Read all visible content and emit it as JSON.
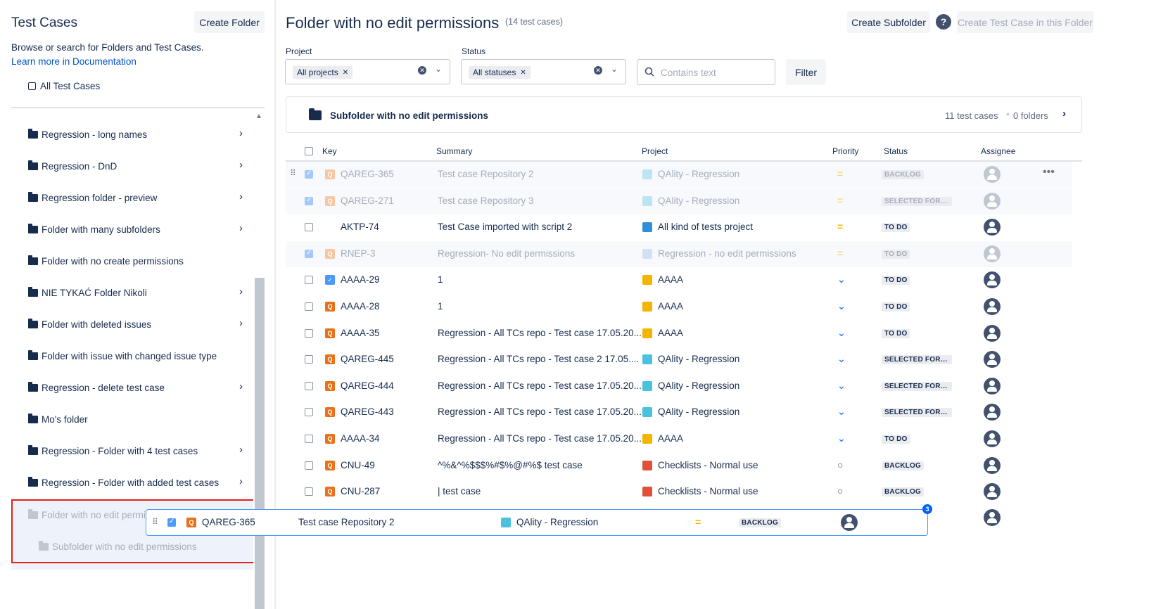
{
  "sidebar": {
    "title": "Test Cases",
    "create_folder_label": "Create Folder",
    "description": "Browse or search for Folders and Test Cases.",
    "learn_more_link": "Learn more in Documentation",
    "all_test_cases_label": "All Test Cases",
    "folders": [
      {
        "label": "Regression - long names",
        "has_children": true
      },
      {
        "label": "Regression - DnD",
        "has_children": true
      },
      {
        "label": "Regression folder - preview",
        "has_children": true
      },
      {
        "label": "Folder with many subfolders",
        "has_children": true
      },
      {
        "label": "Folder with no create permissions",
        "has_children": false
      },
      {
        "label": "NIE TYKAĆ Folder Nikoli",
        "has_children": true
      },
      {
        "label": "Folder with deleted issues",
        "has_children": true
      },
      {
        "label": "Folder with issue with changed issue type",
        "has_children": false
      },
      {
        "label": "Regression - delete test case",
        "has_children": true
      },
      {
        "label": "Mo's folder",
        "has_children": false
      },
      {
        "label": "Regression - Folder with 4 test cases",
        "has_children": true
      },
      {
        "label": "Regression - Folder with added test cases",
        "has_children": true
      }
    ],
    "ghost_folders": [
      {
        "label": "Folder with no edit permis"
      },
      {
        "label": "Subfolder with no edit permissions"
      }
    ]
  },
  "header": {
    "title": "Folder with no edit permissions",
    "count": "(14 test cases)",
    "create_subfolder_label": "Create Subfolder",
    "help_label": "?",
    "create_test_case_label": "Create Test Case in this Folder"
  },
  "filters": {
    "project_label": "Project",
    "project_chip": "All projects",
    "status_label": "Status",
    "status_chip": "All statuses",
    "search_placeholder": "Contains text",
    "filter_button": "Filter"
  },
  "subfolder_card": {
    "name": "Subfolder with no edit permissions",
    "test_cases": "11 test cases",
    "folders": "0 folders"
  },
  "table": {
    "columns": [
      "Key",
      "Summary",
      "Project",
      "Priority",
      "Status",
      "Assignee"
    ],
    "rows": [
      {
        "key": "QAREG-365",
        "summary": "Test case Repository 2",
        "project": "QAlity - Regression",
        "priority": "=",
        "status": "BACKLOG",
        "selected": true,
        "faded": true,
        "type": "orange",
        "pcolor": "#4bc1e0"
      },
      {
        "key": "QAREG-271",
        "summary": "Test case Repository 3",
        "project": "QAlity - Regression",
        "priority": "=",
        "status": "SELECTED FOR I...",
        "selected": true,
        "faded": true,
        "type": "orange",
        "pcolor": "#4bc1e0"
      },
      {
        "key": "AKTP-74",
        "summary": "Test Case imported with script 2",
        "project": "All kind of tests project",
        "priority": "=",
        "status": "TO DO",
        "selected": false,
        "faded": false,
        "type": "none",
        "pcolor": "#2f8fd8"
      },
      {
        "key": "RNEP-3",
        "summary": "Regression- No edit permissions",
        "project": "Regression - no edit permissions",
        "priority": "=",
        "status": "TO DO",
        "selected": true,
        "faded": true,
        "type": "orange",
        "pcolor": "#8eb3f0"
      },
      {
        "key": "AAAA-29",
        "summary": "1",
        "project": "AAAA",
        "priority": "⌄",
        "status": "TO DO",
        "selected": false,
        "faded": false,
        "type": "blue",
        "pcolor": "#f5b400"
      },
      {
        "key": "AAAA-28",
        "summary": "1",
        "project": "AAAA",
        "priority": "⌄",
        "status": "TO DO",
        "selected": false,
        "faded": false,
        "type": "orange",
        "pcolor": "#f5b400"
      },
      {
        "key": "AAAA-35",
        "summary": "Regression - All TCs repo - Test case 17.05.20...",
        "project": "AAAA",
        "priority": "⌄",
        "status": "TO DO",
        "selected": false,
        "faded": false,
        "type": "orange",
        "pcolor": "#f5b400"
      },
      {
        "key": "QAREG-445",
        "summary": "Regression - All TCs repo - Test case 2 17.05....",
        "project": "QAlity - Regression",
        "priority": "⌄",
        "status": "SELECTED FOR I...",
        "selected": false,
        "faded": false,
        "type": "orange",
        "pcolor": "#4bc1e0"
      },
      {
        "key": "QAREG-444",
        "summary": "Regression - All TCs repo - Test case 17.05.20...",
        "project": "QAlity - Regression",
        "priority": "⌄",
        "status": "SELECTED FOR I...",
        "selected": false,
        "faded": false,
        "type": "orange",
        "pcolor": "#4bc1e0"
      },
      {
        "key": "QAREG-443",
        "summary": "Regression - All TCs repo - Test case 17.05.20...",
        "project": "QAlity - Regression",
        "priority": "⌄",
        "status": "SELECTED FOR I...",
        "selected": false,
        "faded": false,
        "type": "orange",
        "pcolor": "#4bc1e0"
      },
      {
        "key": "AAAA-34",
        "summary": "Regression - All TCs repo - Test case 17.05.20...",
        "project": "AAAA",
        "priority": "⌄",
        "status": "TO DO",
        "selected": false,
        "faded": false,
        "type": "orange",
        "pcolor": "#f5b400"
      },
      {
        "key": "CNU-49",
        "summary": "^%&^%$$$%#$%@#%$ test case",
        "project": "Checklists - Normal use",
        "priority": "○",
        "status": "BACKLOG",
        "selected": false,
        "faded": false,
        "type": "orange",
        "pcolor": "#e2503a"
      },
      {
        "key": "CNU-287",
        "summary": "| test case",
        "project": "Checklists - Normal use",
        "priority": "○",
        "status": "BACKLOG",
        "selected": false,
        "faded": false,
        "type": "orange",
        "pcolor": "#e2503a"
      }
    ]
  },
  "drag_preview": {
    "key": "QAREG-365",
    "summary": "Test case Repository 2",
    "project": "QAlity - Regression",
    "priority": "=",
    "status": "BACKLOG",
    "count_badge": "3"
  },
  "colors": {
    "link": "#0052cc",
    "issue_type": "#e8711a",
    "priority_medium": "#f5b400",
    "priority_low": "#2684ff",
    "drag_border": "#4c9aff",
    "highlight_box": "#e2231a"
  }
}
